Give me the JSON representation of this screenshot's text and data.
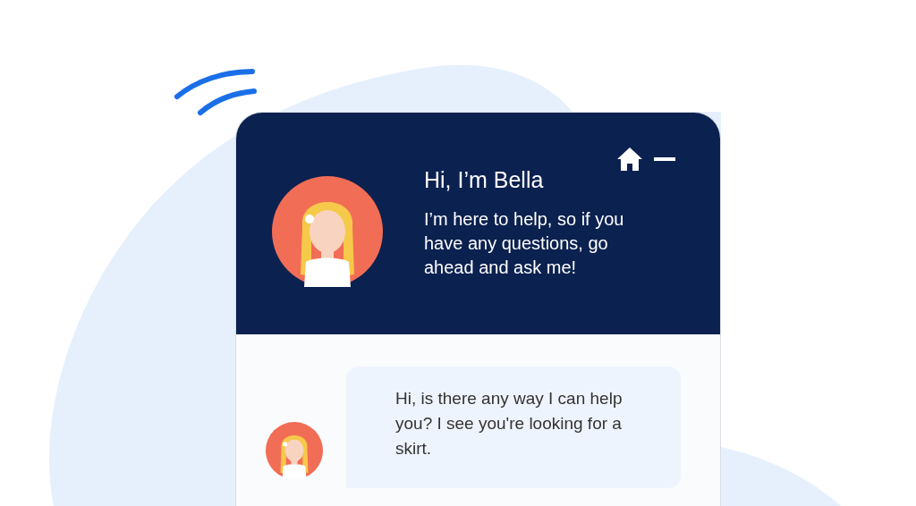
{
  "chat_widget": {
    "header": {
      "title": "Hi, I’m Bella",
      "message": "I’m here to help, so if you have any questions, go ahead and ask me!"
    },
    "messages": [
      {
        "text": "Hi, is there any way I can help you? I see you're looking for a skirt."
      }
    ]
  }
}
